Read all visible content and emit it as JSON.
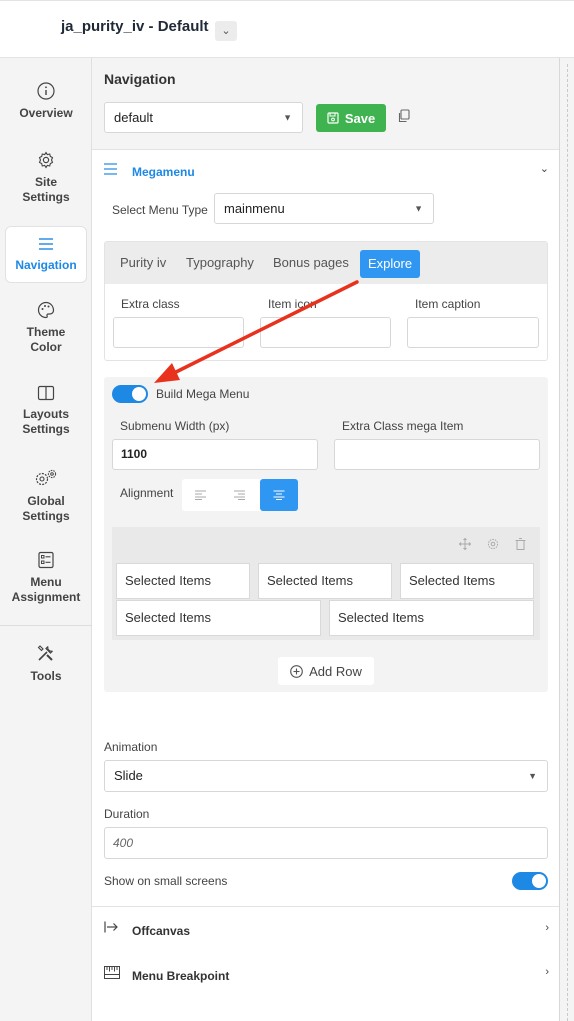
{
  "header": {
    "title": "ja_purity_iv - Default",
    "dropdown_icon": "chevron-down"
  },
  "sidebar": {
    "items": [
      {
        "label": "Overview",
        "icon": "info-icon"
      },
      {
        "label": "Site Settings",
        "icon": "gear-icon"
      },
      {
        "label": "Navigation",
        "icon": "menu-icon"
      },
      {
        "label": "Theme Color",
        "icon": "palette-icon"
      },
      {
        "label": "Layouts Settings",
        "icon": "layout-icon"
      },
      {
        "label": "Global Settings",
        "icon": "gears-icon"
      },
      {
        "label": "Menu Assignment",
        "icon": "checklist-icon"
      },
      {
        "label": "Tools",
        "icon": "tools-icon"
      }
    ],
    "active": "Navigation",
    "accent": "#1e88e5"
  },
  "navigation": {
    "title": "Navigation",
    "preset": "default",
    "save_label": "Save",
    "save_color": "#3fb34f"
  },
  "megamenu": {
    "title": "Megamenu",
    "select_menu_type_label": "Select Menu Type",
    "menu_type": "mainmenu",
    "tabs": [
      "Purity iv",
      "Typography",
      "Bonus pages",
      "Explore"
    ],
    "active_tab": "Explore",
    "fields": {
      "extra_class_label": "Extra class",
      "item_icon_label": "Item icon",
      "item_caption_label": "Item caption"
    },
    "build_mega_menu_label": "Build Mega Menu",
    "build_mega_menu_on": true,
    "submenu_width_label": "Submenu Width (px)",
    "submenu_width": "1100",
    "extra_class_mega_label": "Extra Class mega Item",
    "alignment_label": "Alignment",
    "alignment_active": "center",
    "grid_rows": [
      [
        "Selected Items",
        "Selected Items",
        "Selected Items"
      ],
      [
        "Selected Items",
        "Selected Items"
      ]
    ],
    "add_row_label": "Add Row",
    "animation_label": "Animation",
    "animation": "Slide",
    "duration_label": "Duration",
    "duration_placeholder": "400",
    "small_screens_label": "Show on small screens",
    "small_screens_on": true
  },
  "sections": [
    {
      "title": "Offcanvas",
      "icon": "offcanvas-icon"
    },
    {
      "title": "Menu Breakpoint",
      "icon": "ruler-icon"
    }
  ],
  "annotation": {
    "arrow_color": "#e8321e"
  }
}
